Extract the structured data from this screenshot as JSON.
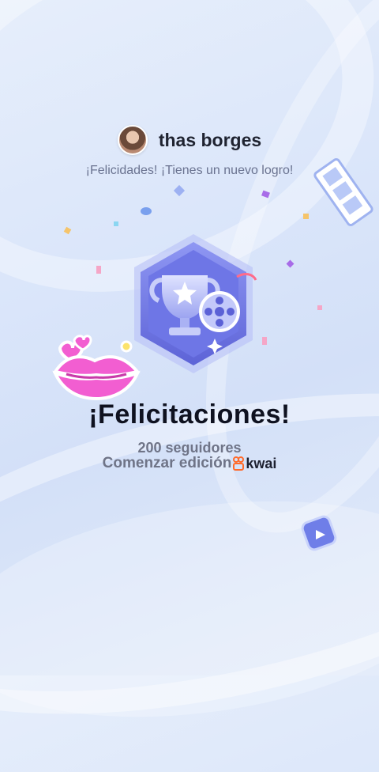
{
  "user": {
    "name": "thas borges"
  },
  "header": {
    "subtitle": "¡Felicidades! ¡Tienes un nuevo logro!"
  },
  "achievement": {
    "title": "¡Felicitaciones!",
    "followers_text": "200 seguidores",
    "edit_text": "Comenzar edición",
    "brand": "kwai"
  },
  "colors": {
    "badge_primary": "#7d86ee",
    "badge_dark": "#5b61d6",
    "lips": "#f25ed1",
    "kwai_orange": "#ff6a2a",
    "background": "#dbe6fa"
  },
  "icons": {
    "badge": "trophy-badge-icon",
    "film": "film-strip-icon",
    "play": "play-icon",
    "sticker": "lips-sticker-icon"
  }
}
